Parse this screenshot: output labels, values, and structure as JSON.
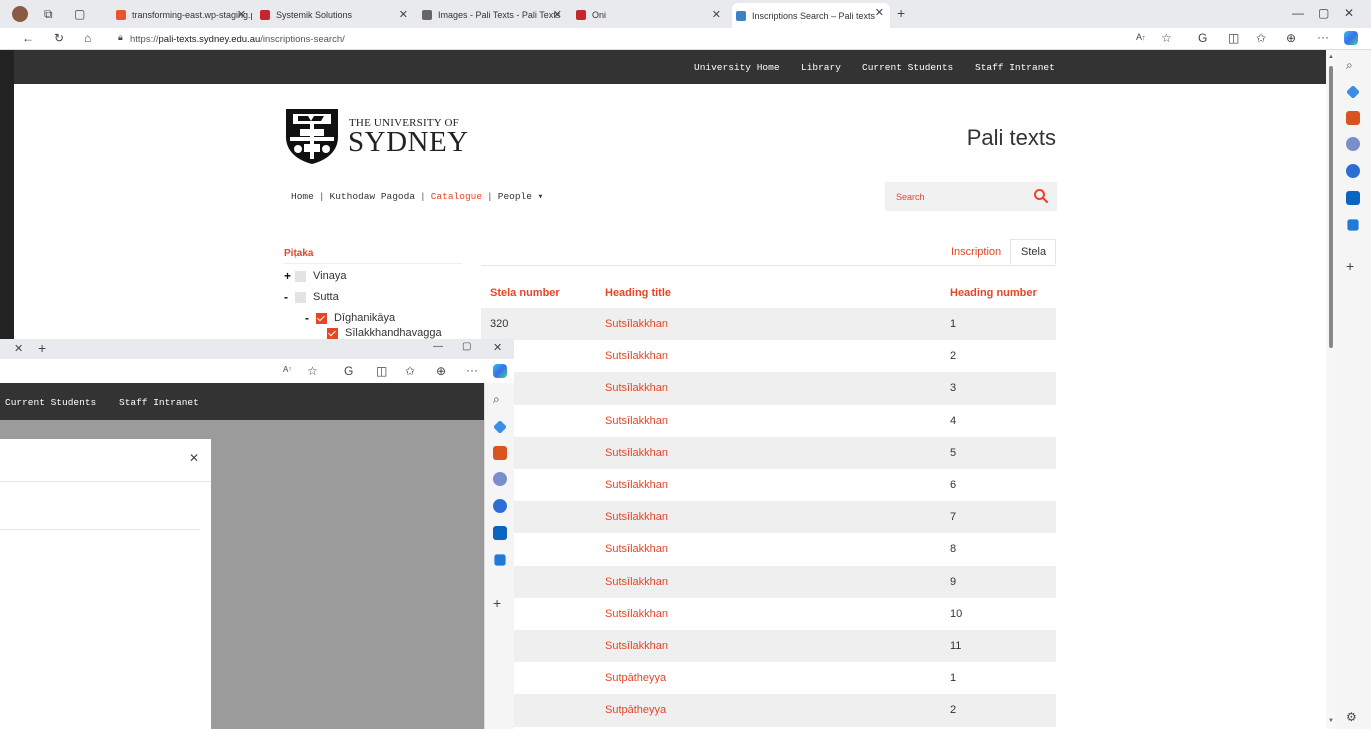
{
  "browser": {
    "tabs": [
      {
        "label": "transforming-east.wp-staging.pr",
        "color": "#e8542f"
      },
      {
        "label": "Systemik Solutions",
        "color": "#c4262e"
      },
      {
        "label": "Images - Pali Texts - Pali Texts",
        "color": "#666666"
      },
      {
        "label": "Oni",
        "color": "#c4262e"
      },
      {
        "label": "Inscriptions Search – Pali texts",
        "color": "#3b82c4"
      }
    ],
    "url_prefix": "https://",
    "url_domain": "pali-texts.sydney.edu.au",
    "url_path": "/inscriptions-search/"
  },
  "site": {
    "top_nav": [
      "University Home",
      "Library",
      "Current Students",
      "Staff Intranet"
    ],
    "logo_line1": "THE UNIVERSITY OF",
    "logo_line2": "SYDNEY",
    "title": "Pali texts",
    "breadcrumb": {
      "home": "Home",
      "kuthodaw": "Kuthodaw Pagoda",
      "catalogue": "Catalogue",
      "people": "People ▾"
    },
    "search_placeholder": "Search"
  },
  "tree": {
    "title": "Piṭaka",
    "nodes": [
      {
        "toggle": "+",
        "label": "Vinaya",
        "checked": false
      },
      {
        "toggle": "-",
        "label": "Sutta",
        "checked": false
      },
      {
        "toggle": "-",
        "label": "Dīghanikāya",
        "checked": true
      },
      {
        "toggle": "",
        "label": "Sīlakkhandhavagga",
        "checked": true
      }
    ]
  },
  "results": {
    "tabs": {
      "inscription": "Inscription",
      "stela": "Stela"
    },
    "columns": {
      "stela_number": "Stela number",
      "heading_title": "Heading title",
      "heading_number": "Heading number"
    },
    "rows": [
      {
        "stela": "320",
        "title": "Sutsīlakkhan",
        "number": "1"
      },
      {
        "stela": "",
        "title": "Sutsīlakkhan",
        "number": "2"
      },
      {
        "stela": "",
        "title": "Sutsīlakkhan",
        "number": "3"
      },
      {
        "stela": "",
        "title": "Sutsīlakkhan",
        "number": "4"
      },
      {
        "stela": "",
        "title": "Sutsīlakkhan",
        "number": "5"
      },
      {
        "stela": "",
        "title": "Sutsīlakkhan",
        "number": "6"
      },
      {
        "stela": "",
        "title": "Sutsīlakkhan",
        "number": "7"
      },
      {
        "stela": "",
        "title": "Sutsīlakkhan",
        "number": "8"
      },
      {
        "stela": "",
        "title": "Sutsīlakkhan",
        "number": "9"
      },
      {
        "stela": "",
        "title": "Sutsīlakkhan",
        "number": "10"
      },
      {
        "stela": "",
        "title": "Sutsīlakkhan",
        "number": "11"
      },
      {
        "stela": "",
        "title": "Sutpātheyya",
        "number": "1"
      },
      {
        "stela": "",
        "title": "Sutpātheyya",
        "number": "2"
      }
    ]
  },
  "overlay": {
    "nav": [
      "Current Students",
      "Staff Intranet"
    ]
  },
  "colors": {
    "accent": "#e64626",
    "nav_bg": "#333333"
  }
}
